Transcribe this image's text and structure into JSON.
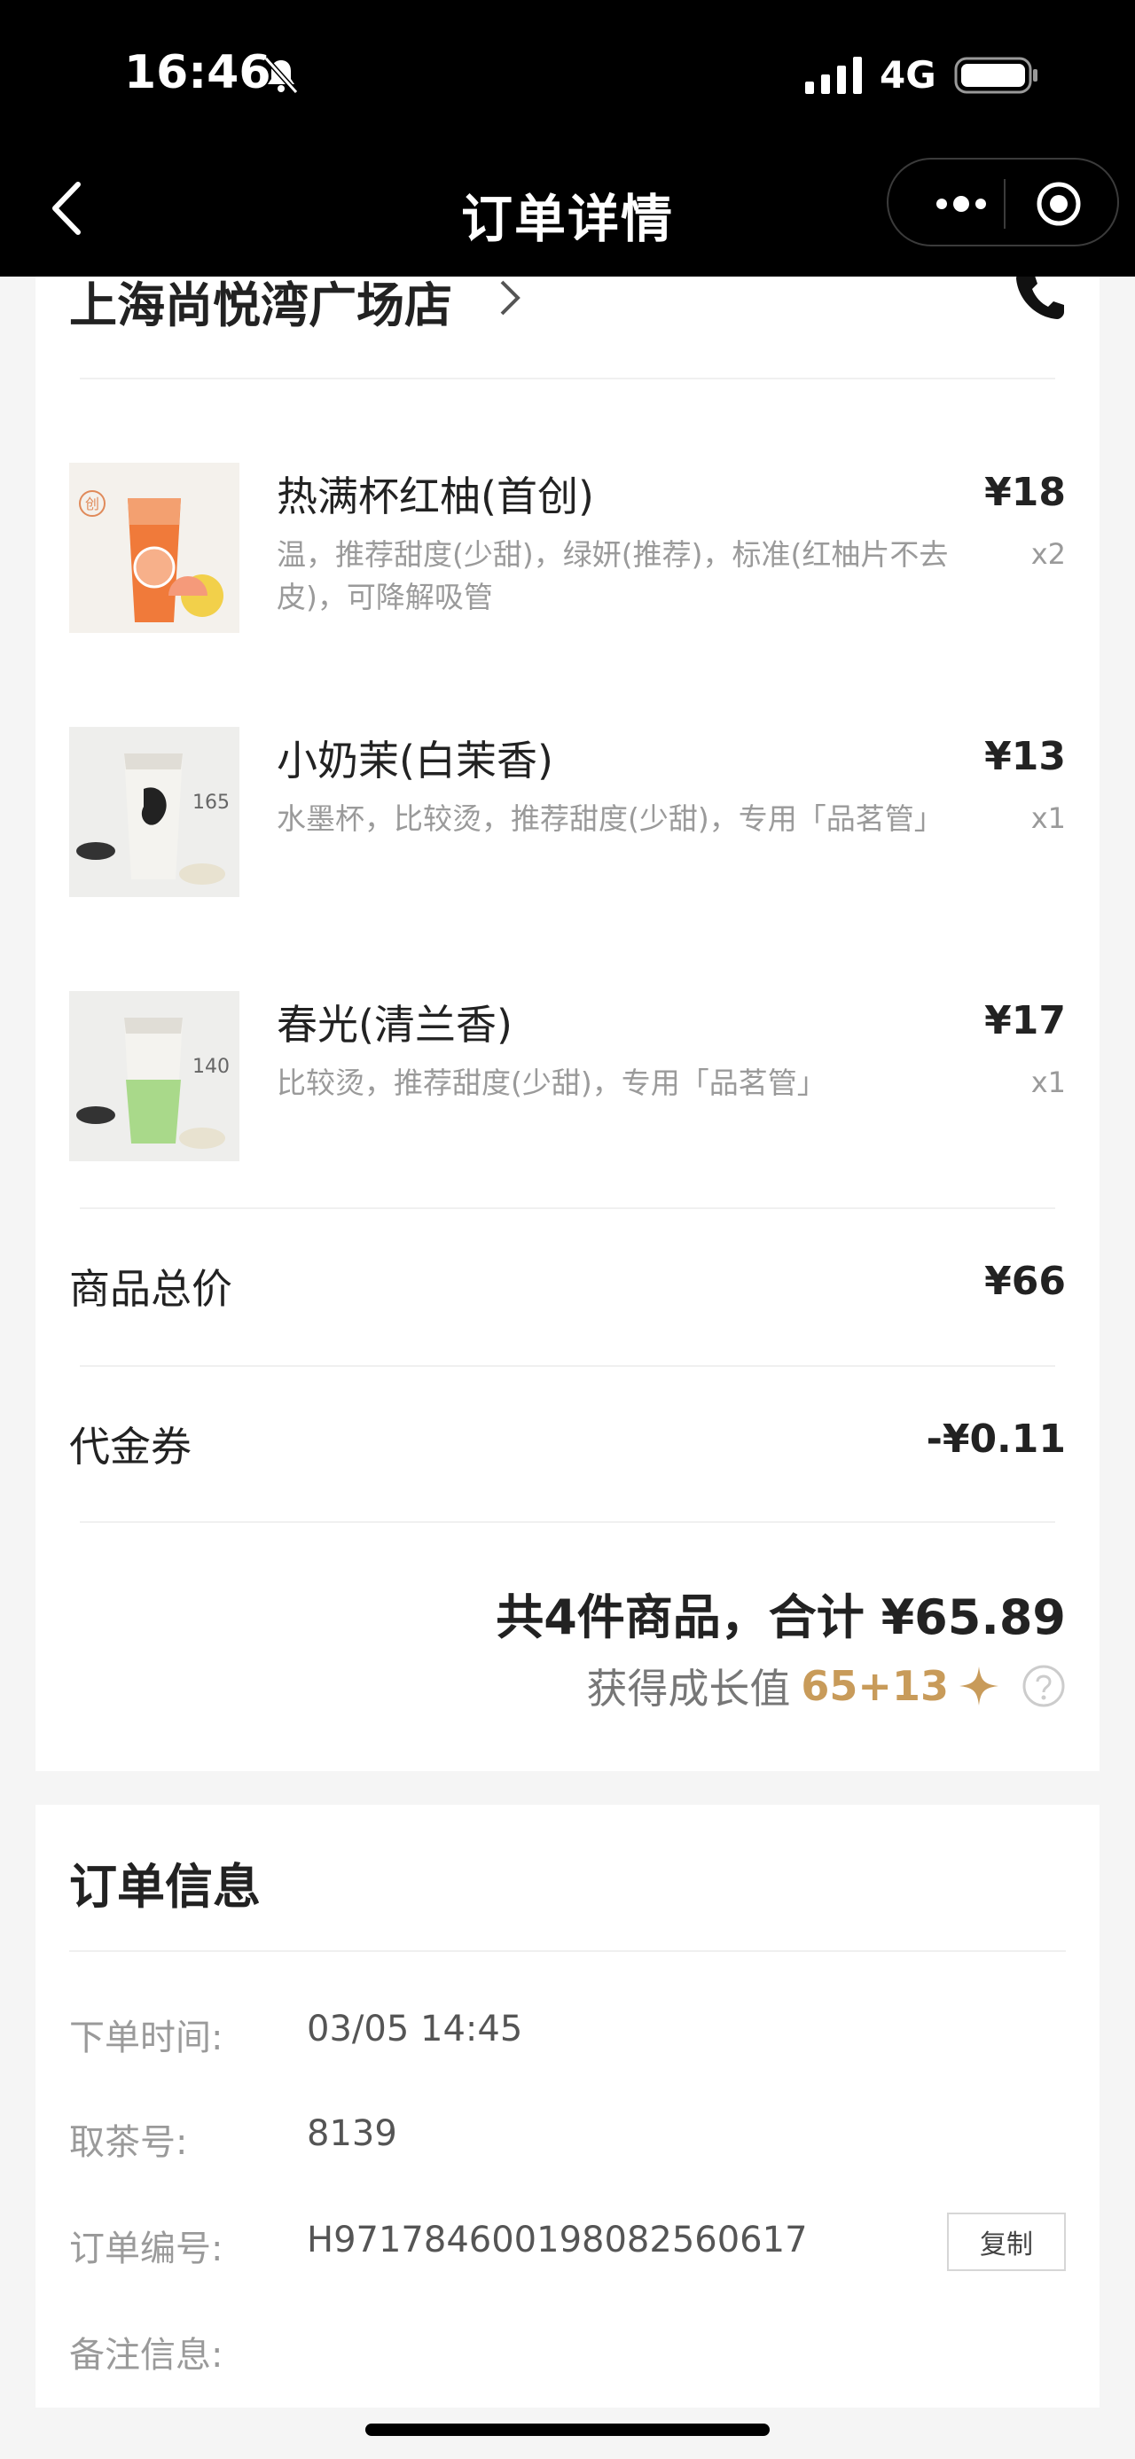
{
  "status_bar": {
    "time": "16:46",
    "network": "4G"
  },
  "nav": {
    "title": "订单详情"
  },
  "store": {
    "name": "上海尚悦湾广场店"
  },
  "items": [
    {
      "name": "热满杯红柚(首创)",
      "desc": "温，推荐甜度(少甜)，绿妍(推荐)，标准(红柚片不去皮)，可降解吸管",
      "price": "¥18",
      "qty": "x2",
      "badge": "创"
    },
    {
      "name": "小奶茉(白茉香)",
      "desc": "水墨杯，比较烫，推荐甜度(少甜)，专用「品茗管」",
      "price": "¥13",
      "qty": "x1",
      "cup_label": "165"
    },
    {
      "name": "春光(清兰香)",
      "desc": "比较烫，推荐甜度(少甜)，专用「品茗管」",
      "price": "¥17",
      "qty": "x1",
      "cup_label": "140"
    }
  ],
  "summary": {
    "subtotal_label": "商品总价",
    "subtotal_value": "¥66",
    "voucher_label": "代金券",
    "voucher_value": "-¥0.11",
    "total_text": "共4件商品，合计 ¥65.89",
    "growth_label": "获得成长值",
    "growth_value": "65+13"
  },
  "order_info": {
    "title": "订单信息",
    "time_label": "下单时间:",
    "time_value": "03/05 14:45",
    "pickup_label": "取茶号:",
    "pickup_value": "8139",
    "number_label": "订单编号:",
    "number_value": "H971784600198082560617",
    "copy_label": "复制",
    "remark_label": "备注信息:"
  },
  "colors": {
    "accent_gold": "#c89b5a",
    "topbar": "#000000"
  }
}
